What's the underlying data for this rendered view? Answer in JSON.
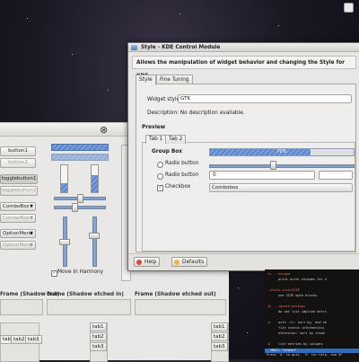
{
  "wf": {
    "buttons": [
      "button1",
      "button2",
      "togglebutton1",
      "togglebutton2"
    ],
    "combos": [
      "ComboBox",
      "ComboBox",
      "OptionMenu",
      "OptionMenu"
    ],
    "checkbox_label": "Move In Harmony",
    "vprogress": [
      0.35,
      0.65
    ],
    "vsliders": [
      0.5,
      0.35
    ],
    "frames": [
      "Frame (Shadow out)",
      "Frame (Shadow etched in)",
      "Frame (Shadow etched out)"
    ],
    "tabs_bottom": [
      "tab1",
      "tab2",
      "tab3"
    ],
    "tab1": "tab1",
    "tab2": "tab2",
    "tab3": "tab3"
  },
  "dialog": {
    "title": "Style - KDE Control Module",
    "header": "Allows the manipulation of widget behavior and changing the Style for KDE",
    "tabs": [
      "Style",
      "Fine Tuning"
    ],
    "widget_style_label": "Widget style:",
    "widget_style_value": "GTK",
    "description": "Description: No description available.",
    "preview_label": "Preview",
    "preview_tabs": [
      "Tab 1",
      "Tab 2"
    ],
    "groupbox_label": "Group Box",
    "radio1": "Radio button",
    "radio2": "Radio button",
    "checkbox": "Checkbox",
    "progress_text": "70%",
    "progress_value": 0.7,
    "spin_value": "0",
    "combo_value": "Combobox",
    "help": "Help",
    "defaults": "Defaults",
    "colors": {
      "accent": "#5d86c8",
      "titlebar": "#d3d1cd"
    }
  },
  "terminal": {
    "lines": [
      {
        "t": "-b, --escape",
        "c": "opt"
      },
      {
        "t": "      print octal escapes for n",
        "c": ""
      },
      {
        "t": "",
        "c": ""
      },
      {
        "t": "--block-size=SIZE",
        "c": "opt"
      },
      {
        "t": "      use SIZE-byte blocks",
        "c": ""
      },
      {
        "t": "",
        "c": ""
      },
      {
        "t": "-B, --ignore-backups",
        "c": "opt"
      },
      {
        "t": "      do not list implied entri",
        "c": ""
      },
      {
        "t": "",
        "c": ""
      },
      {
        "t": "-c    with -lt: sort by, and sh",
        "c": ""
      },
      {
        "t": "      file status information)",
        "c": ""
      },
      {
        "t": "      otherwise: sort by ctime",
        "c": ""
      },
      {
        "t": "",
        "c": ""
      },
      {
        "t": "-C    list entries by columns",
        "c": ""
      }
    ],
    "status": "-- MOST: *stdin*",
    "help_line": "Press `Q' to quit, `H' for help, and SP"
  }
}
